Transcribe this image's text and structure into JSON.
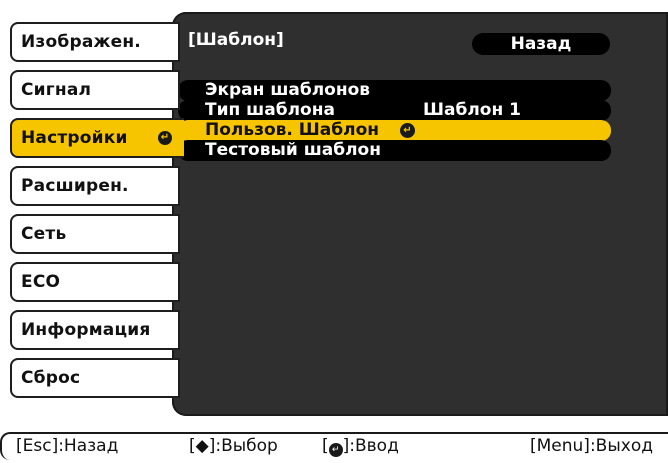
{
  "sidebar": {
    "items": [
      {
        "label": "Изображен."
      },
      {
        "label": "Сигнал"
      },
      {
        "label": "Настройки",
        "active": true
      },
      {
        "label": "Расширен."
      },
      {
        "label": "Сеть"
      },
      {
        "label": "ECO"
      },
      {
        "label": "Информация"
      },
      {
        "label": "Сброс"
      }
    ]
  },
  "panel": {
    "title": "[Шаблон]",
    "back_label": "Назад",
    "items": [
      {
        "label": "Экран шаблонов"
      },
      {
        "label": "Тип шаблона",
        "value": "Шаблон 1"
      },
      {
        "label": "Пользов. Шаблон",
        "selected": true
      },
      {
        "label": "Тестовый шаблон"
      }
    ]
  },
  "help_bar": {
    "esc": "[Esc]:Назад",
    "select": "[◆]:Выбор",
    "enter_open": "[",
    "enter_close": "]:Ввод",
    "menu": "[Menu]:Выход"
  },
  "colors": {
    "highlight": "#f7c400",
    "panel_bg": "#2f2f2f",
    "row_bg": "#000000"
  },
  "icons": {
    "enter": "enter-icon",
    "updown": "up-down-arrow-icon"
  }
}
